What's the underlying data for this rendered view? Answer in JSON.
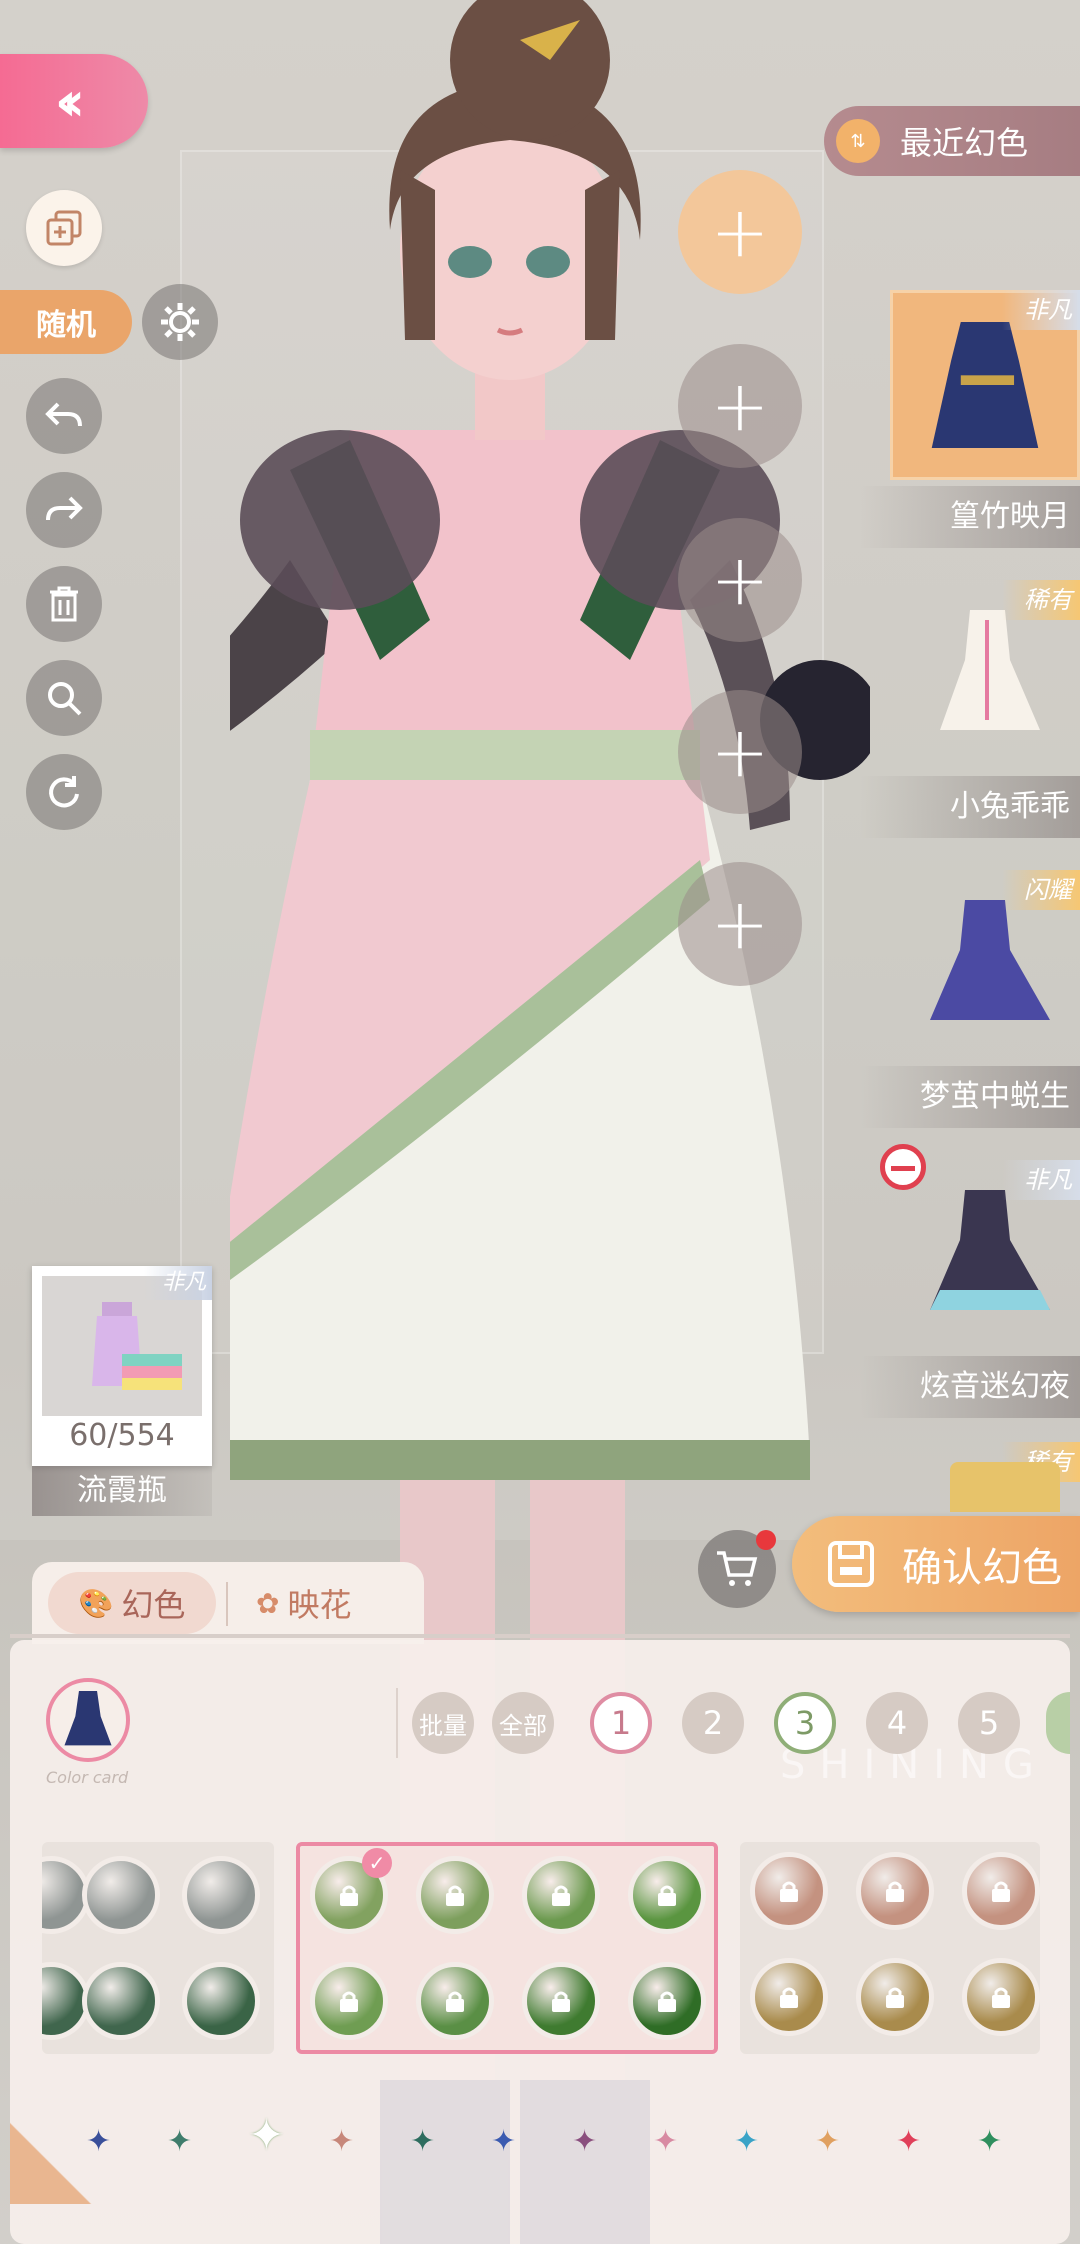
{
  "recent": {
    "label": "最近幻色"
  },
  "toolbar": {
    "random_label": "随机"
  },
  "items": [
    {
      "name": "篁竹映月",
      "rarity": "非凡"
    },
    {
      "name": "小兔乖乖",
      "rarity": "稀有"
    },
    {
      "name": "梦茧中蜕生",
      "rarity": "闪耀"
    },
    {
      "name": "炫音迷幻夜",
      "rarity": "非凡"
    },
    {
      "name": "",
      "rarity": "稀有"
    }
  ],
  "material": {
    "count": "60/554",
    "name": "流霞瓶",
    "rarity": "非凡"
  },
  "confirm": {
    "label": "确认幻色"
  },
  "tabs": {
    "dye": "幻色",
    "bloom": "映花"
  },
  "panel": {
    "batch": "批量",
    "all": "全部",
    "numbers": [
      "1",
      "2",
      "3",
      "4",
      "5"
    ],
    "card_caption": "Color card",
    "watermark": "SHINING"
  },
  "colors": {
    "accent_pink": "#ec8aa4",
    "accent_orange": "#eda566",
    "group1": [
      "#8f9593",
      "#8f9593",
      "#40664d",
      "#3a6446"
    ],
    "group2": [
      "#82a260",
      "#7d9f5d",
      "#6c9a4f",
      "#5a9540",
      "#6f9d52",
      "#5a8f45",
      "#3f7b30",
      "#2f6d26"
    ],
    "group3": [
      "#c49280",
      "#c49280",
      "#c49280",
      "#a98b4c",
      "#a98b4c",
      "#a98b4c"
    ],
    "stars": [
      "#3a4f9a",
      "#3f7d6c",
      "#ffffff",
      "#c7877a",
      "#2e6d5f",
      "#3a5ab0",
      "#8a4f7e",
      "#d88aa2",
      "#3aa3c7",
      "#e0a060",
      "#e0405a",
      "#2f8f5e"
    ]
  }
}
